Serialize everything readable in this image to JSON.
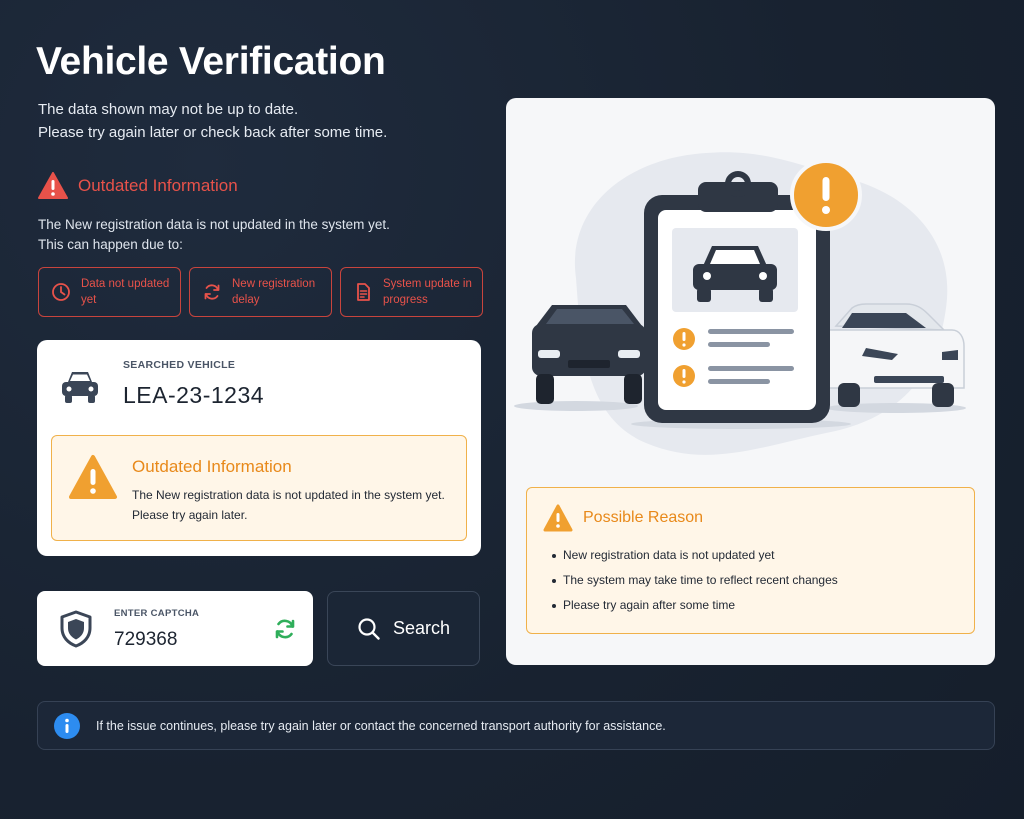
{
  "header": {
    "title": "Vehicle Verification",
    "subtitle_line1": "The data shown may not be up to date.",
    "subtitle_line2": "Please try again later or check back after some time."
  },
  "warning": {
    "heading": "Outdated Information",
    "desc_line1": "The New registration data is not updated in the system yet.",
    "desc_line2": "This can happen due to:",
    "reasons": [
      {
        "icon": "clock-icon",
        "label": "Data not updated yet"
      },
      {
        "icon": "refresh-icon",
        "label": "New registration delay"
      },
      {
        "icon": "document-icon",
        "label": "System update in progress"
      }
    ]
  },
  "vehicle": {
    "label": "SEARCHED VEHICLE",
    "plate": "LEA-23-1234",
    "alert_title": "Outdated Information",
    "alert_line1": "The New registration data is not updated in the system yet.",
    "alert_line2": "Please try again later."
  },
  "captcha": {
    "label": "ENTER CAPTCHA",
    "value": "729368"
  },
  "search": {
    "label": "Search"
  },
  "possible_reason": {
    "title": "Possible Reason",
    "items": [
      "New registration data is not updated yet",
      "The system may take time to reflect recent changes",
      "Please try again after some time"
    ]
  },
  "info": {
    "text": "If the issue continues, please try again later or contact the concerned transport authority for assistance."
  },
  "colors": {
    "background": "#1a2535",
    "error_red": "#e8524a",
    "warning_orange": "#f0a030",
    "info_blue": "#2d8cf0",
    "refresh_green": "#2fae5a"
  }
}
